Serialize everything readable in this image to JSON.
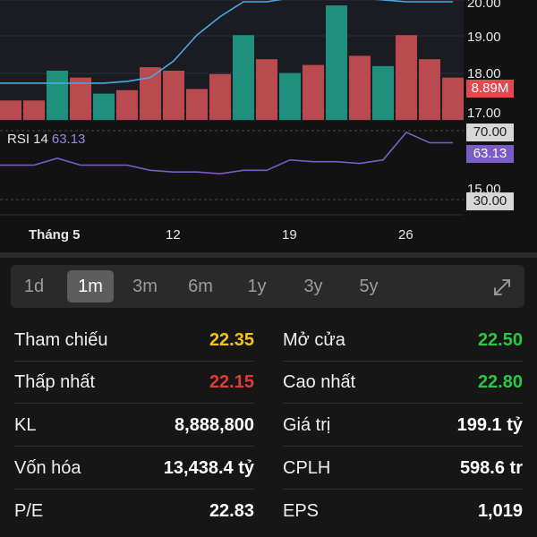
{
  "chart": {
    "price_labels": [
      "20.00",
      "19.00",
      "18.00",
      "17.00",
      "15.00"
    ],
    "volume_tag": "8.89M",
    "rsi_label": "RSI 14",
    "rsi_value": "63.13",
    "rsi_upper": "70.00",
    "rsi_lower": "30.00",
    "x_labels": [
      "Tháng 5",
      "12",
      "19",
      "26"
    ],
    "colors": {
      "up": "#1f8f7e",
      "down": "#b84a50",
      "price_line": "#4aa8e0",
      "rsi_line": "#7b5cc7"
    }
  },
  "chart_data": {
    "type": "bar",
    "volume_bars": [
      {
        "dir": "down",
        "level": 0.17
      },
      {
        "dir": "down",
        "level": 0.17
      },
      {
        "dir": "up",
        "level": 0.43
      },
      {
        "dir": "down",
        "level": 0.37
      },
      {
        "dir": "up",
        "level": 0.23
      },
      {
        "dir": "down",
        "level": 0.26
      },
      {
        "dir": "down",
        "level": 0.46
      },
      {
        "dir": "down",
        "level": 0.43
      },
      {
        "dir": "down",
        "level": 0.27
      },
      {
        "dir": "down",
        "level": 0.4
      },
      {
        "dir": "up",
        "level": 0.74
      },
      {
        "dir": "down",
        "level": 0.53
      },
      {
        "dir": "up",
        "level": 0.41
      },
      {
        "dir": "down",
        "level": 0.48
      },
      {
        "dir": "up",
        "level": 1.0
      },
      {
        "dir": "down",
        "level": 0.56
      },
      {
        "dir": "up",
        "level": 0.47
      },
      {
        "dir": "down",
        "level": 0.74
      },
      {
        "dir": "down",
        "level": 0.53
      },
      {
        "dir": "down",
        "level": 0.37
      }
    ],
    "price_line": [
      17.8,
      17.8,
      17.8,
      17.8,
      17.8,
      17.85,
      17.95,
      18.4,
      19.1,
      19.6,
      20.0,
      20.0,
      20.1,
      20.1,
      20.1,
      20.1,
      20.05,
      20.0,
      20.0,
      20.0
    ],
    "rsi_line": [
      50,
      50,
      54,
      50,
      50,
      50,
      47,
      46,
      46,
      45,
      47,
      47,
      53,
      52,
      52,
      51,
      53,
      69,
      63,
      63
    ]
  },
  "timeframes": [
    "1d",
    "1m",
    "3m",
    "6m",
    "1y",
    "3y",
    "5y"
  ],
  "active_timeframe": "1m",
  "stats_left": [
    {
      "label": "Tham chiếu",
      "value": "22.35",
      "color": "#f0c419"
    },
    {
      "label": "Thấp nhất",
      "value": "22.15",
      "color": "#e03b3b"
    },
    {
      "label": "KL",
      "value": "8,888,800",
      "color": "#ffffff"
    },
    {
      "label": "Vốn hóa",
      "value": "13,438.4 tỷ",
      "color": "#ffffff"
    },
    {
      "label": "P/E",
      "value": "22.83",
      "color": "#ffffff"
    }
  ],
  "stats_right": [
    {
      "label": "Mở cửa",
      "value": "22.50",
      "color": "#28c840"
    },
    {
      "label": "Cao nhất",
      "value": "22.80",
      "color": "#28c840"
    },
    {
      "label": "Giá trị",
      "value": "199.1 tỷ",
      "color": "#ffffff"
    },
    {
      "label": "CPLH",
      "value": "598.6 tr",
      "color": "#ffffff"
    },
    {
      "label": "EPS",
      "value": "1,019",
      "color": "#ffffff"
    }
  ]
}
